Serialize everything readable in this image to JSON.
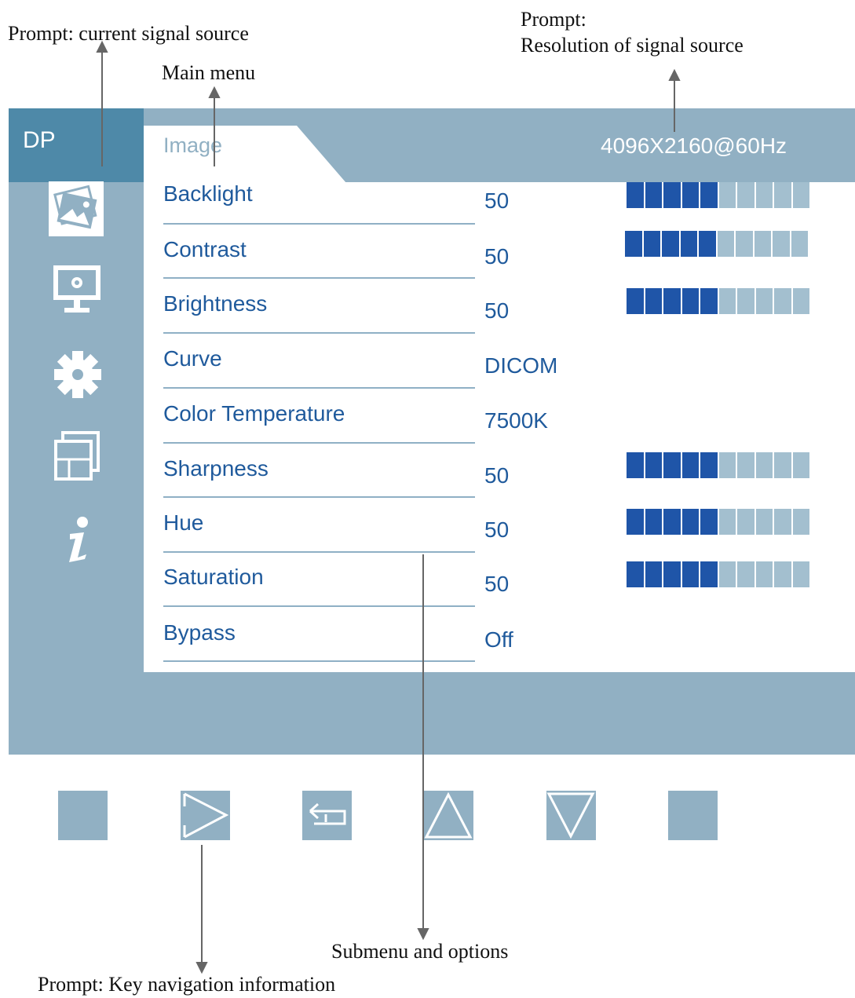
{
  "annotations": {
    "current_signal_source": "Prompt: current signal source",
    "main_menu": "Main menu",
    "resolution_prompt_line1": "Prompt:",
    "resolution_prompt_line2": "Resolution of signal source",
    "submenu_options": "Submenu and options",
    "key_navigation": "Prompt: Key navigation information"
  },
  "osd": {
    "signal_source": "DP",
    "active_tab": "Image",
    "resolution": "4096X2160@60Hz",
    "sidebar_icons": [
      "image-icon",
      "monitor-settings-icon",
      "gear-icon",
      "layout-icon",
      "info-icon"
    ],
    "rows": [
      {
        "label": "Backlight",
        "value": "50",
        "bar_level": 0.5
      },
      {
        "label": "Contrast",
        "value": "50",
        "bar_level": 0.5
      },
      {
        "label": "Brightness",
        "value": "50",
        "bar_level": 0.5
      },
      {
        "label": "Curve",
        "value": "DICOM"
      },
      {
        "label": "Color Temperature",
        "value": "7500K"
      },
      {
        "label": "Sharpness",
        "value": "50",
        "bar_level": 0.5
      },
      {
        "label": "Hue",
        "value": "50",
        "bar_level": 0.5
      },
      {
        "label": "Saturation",
        "value": "50",
        "bar_level": 0.5
      },
      {
        "label": "Bypass",
        "value": "Off"
      }
    ],
    "colors": {
      "panel": "#91b0c3",
      "source_box": "#4e89a8",
      "text": "#1f5a9c",
      "bar_on": "#1f55a8",
      "bar_off": "#a3bfcf"
    }
  },
  "keys": [
    "blank-key",
    "right-arrow-key",
    "return-key",
    "up-arrow-key",
    "down-arrow-key",
    "blank-key"
  ]
}
